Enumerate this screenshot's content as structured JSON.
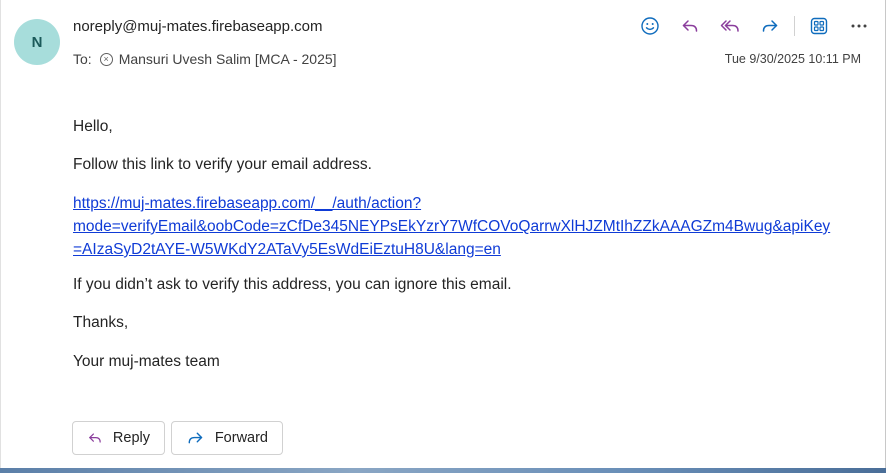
{
  "sender": {
    "avatar_initial": "N",
    "address": "noreply@muj-mates.firebaseapp.com",
    "avatar_color": "#a7dddb"
  },
  "recipients": {
    "to_label": "To:",
    "name": "Mansuri Uvesh Salim [MCA - 2025]"
  },
  "date": "Tue 9/30/2025 10:11 PM",
  "toolbar": {
    "icons": [
      "emoji-icon",
      "reply-icon",
      "reply-all-icon",
      "forward-icon",
      "apps-icon",
      "more-icon"
    ],
    "accent": "#0f6cbd",
    "reply_all_color": "#8a3d9c"
  },
  "message": {
    "greeting": "Hello,",
    "instruction": "Follow this link to verify your email address.",
    "link_line1": "https://muj-mates.firebaseapp.com/__/auth/action?",
    "link_line2": "mode=verifyEmail&oobCode=zCfDe345NEYPsEkYzrY7WfCOVoQarrwXlHJZMtIhZZkAAAGZm4Bwug&apiKey",
    "link_line3": "=AIzaSyD2tAYE-W5WKdY2ATaVy5EsWdEiEztuH8U&lang=en",
    "ignore_note": "If you didn’t ask to verify this address, you can ignore this email.",
    "thanks": "Thanks,",
    "signature": "Your muj-mates team",
    "link_color": "#0f3bd6"
  },
  "actions": {
    "reply_label": "Reply",
    "forward_label": "Forward"
  }
}
